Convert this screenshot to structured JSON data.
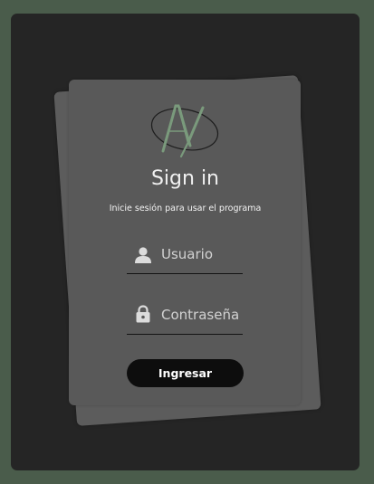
{
  "login": {
    "title": "Sign in",
    "subtitle": "Inicie sesión para usar el programa",
    "username": {
      "placeholder": "Usuario",
      "value": "",
      "icon": "user-icon"
    },
    "password": {
      "placeholder": "Contraseña",
      "value": "",
      "icon": "lock-icon"
    },
    "submit_label": "Ingresar"
  },
  "colors": {
    "background": "#4a5c4b",
    "window": "#252525",
    "card": "#595959",
    "logo": "#7a9a7c",
    "button": "#0d0d0d"
  }
}
